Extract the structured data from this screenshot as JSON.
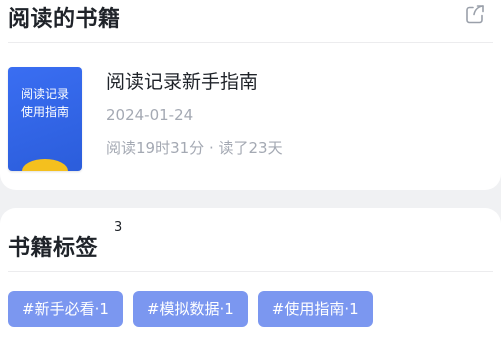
{
  "books_section": {
    "title": "阅读的书籍",
    "share_icon": "share-icon"
  },
  "book": {
    "cover_text": "阅读记录\n使用指南",
    "cover_color": "#2f62e6",
    "title": "阅读记录新手指南",
    "date": "2024-01-24",
    "stats": "阅读19时31分 · 读了23天"
  },
  "tags_section": {
    "title": "书籍标签",
    "count": "3",
    "tags": [
      {
        "label": "#新手必看·1"
      },
      {
        "label": "#模拟数据·1"
      },
      {
        "label": "#使用指南·1"
      }
    ],
    "tag_color": "#7b97f0"
  }
}
